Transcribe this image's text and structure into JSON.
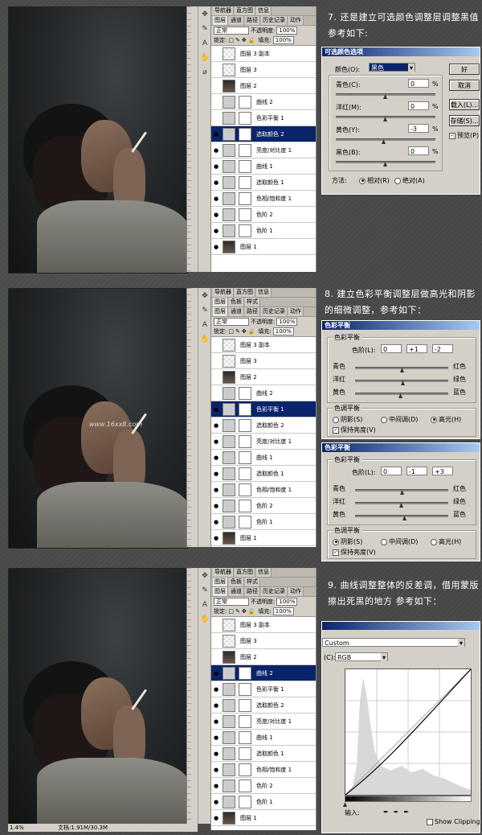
{
  "panel": {
    "tabs1": [
      "导航器",
      "直方图",
      "信息"
    ],
    "tabs2": [
      "图层",
      "通道",
      "路径",
      "历史记录",
      "动作"
    ],
    "tabs2_s3": [
      "图层",
      "色板",
      "样式"
    ],
    "blend": "正常",
    "opacity_label": "不透明度:",
    "opacity": "100%",
    "lock_label": "锁定:",
    "fill_label": "填充:",
    "fill": "100%"
  },
  "layers": [
    {
      "name": "图层 3 副本",
      "kind": "chk",
      "mask": false
    },
    {
      "name": "图层 3",
      "kind": "chk",
      "mask": false
    },
    {
      "name": "图层 2",
      "kind": "img",
      "mask": false
    },
    {
      "name": "曲线 2",
      "kind": "adj",
      "mask": true
    },
    {
      "name": "色彩平衡 1",
      "kind": "adj",
      "mask": true
    },
    {
      "name": "选取颜色 2",
      "kind": "adj",
      "mask": true
    },
    {
      "name": "亮度/对比度 1",
      "kind": "adj",
      "mask": true
    },
    {
      "name": "曲线 1",
      "kind": "adj",
      "mask": true
    },
    {
      "name": "选取颜色 1",
      "kind": "adj",
      "mask": true
    },
    {
      "name": "色相/饱和度 1",
      "kind": "adj",
      "mask": true
    },
    {
      "name": "色阶 2",
      "kind": "adj",
      "mask": true
    },
    {
      "name": "色阶 1",
      "kind": "adj",
      "mask": true
    },
    {
      "name": "图层 1",
      "kind": "img",
      "mask": false
    }
  ],
  "step7": {
    "text1": "7. 还是建立可选颜色调整层调整黑值",
    "text2": "参考如下:",
    "dialog_title": "可选颜色选项",
    "colors_label": "颜色(O):",
    "colors_value": "黑色",
    "cyan": "青色(C):",
    "cyan_val": "0",
    "magenta": "洋红(M):",
    "magenta_val": "0",
    "yellow": "黄色(Y):",
    "yellow_val": "-3",
    "black": "黑色(B):",
    "black_val": "0",
    "pct": "%",
    "method": "方法:",
    "relative": "相对(R)",
    "absolute": "绝对(A)",
    "ok": "好",
    "cancel": "取消",
    "load": "载入(L)...",
    "save": "存储(S)...",
    "preview": "预览(P)"
  },
  "step8": {
    "text1": "8. 建立色彩平衡调整层做高光和阴影",
    "text2": "的细微调整，参考如下：",
    "dialog_title": "色彩平衡",
    "group_balance": "色彩平衡",
    "levels_label": "色阶(L):",
    "cyan": "青色",
    "red": "红色",
    "magenta": "洋红",
    "green": "绿色",
    "yellow": "黄色",
    "blue": "蓝色",
    "group_tone": "色调平衡",
    "shadows": "阴影(S)",
    "midtones": "中间调(D)",
    "highlights": "高光(H)",
    "preserve": "保持亮度(V)",
    "d1": [
      "0",
      "+1",
      "-2"
    ],
    "d2": [
      "0",
      "-1",
      "+3"
    ],
    "watermark": "www.16xx8.com"
  },
  "step9": {
    "text1": "9. 曲线调整整体的反差调，借用蒙版",
    "text2": "擦出死黑的地方   参考如下：",
    "preset": "Custom",
    "channel_label": "(C):",
    "channel": "RGB",
    "input_label": "输入:",
    "show_clipping": "Show Clipping",
    "doc_info": "文档:1.91M/30.3M",
    "zoom": "1.4%"
  }
}
